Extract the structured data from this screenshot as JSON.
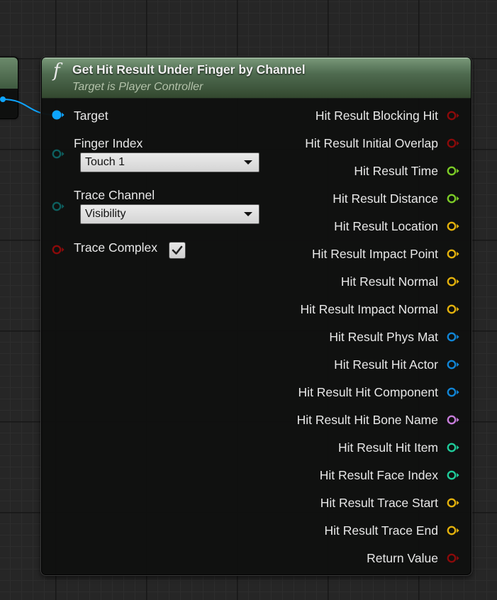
{
  "node": {
    "function_icon": "f",
    "title": "Get Hit Result Under Finger by Channel",
    "subtitle": "Target is Player Controller"
  },
  "inputs": [
    {
      "label": "Target",
      "icon": "object-pin-icon",
      "color": "#0ea5ff"
    },
    {
      "label": "Finger Index",
      "icon": "byte-pin-icon",
      "color": "#0d5f5f",
      "dropdown": "Touch 1"
    },
    {
      "label": "Trace Channel",
      "icon": "byte-pin-icon",
      "color": "#0d5f5f",
      "dropdown": "Visibility"
    },
    {
      "label": "Trace Complex",
      "icon": "bool-pin-icon",
      "color": "#8b0a0a",
      "checked": true
    }
  ],
  "outputs": [
    {
      "label": "Hit Result Blocking Hit",
      "icon": "bool-pin-icon",
      "color": "#8b0a0a"
    },
    {
      "label": "Hit Result Initial Overlap",
      "icon": "bool-pin-icon",
      "color": "#8b0a0a"
    },
    {
      "label": "Hit Result Time",
      "icon": "float-pin-icon",
      "color": "#7ccc27"
    },
    {
      "label": "Hit Result Distance",
      "icon": "float-pin-icon",
      "color": "#7ccc27"
    },
    {
      "label": "Hit Result Location",
      "icon": "vector-pin-icon",
      "color": "#e3b10c"
    },
    {
      "label": "Hit Result Impact Point",
      "icon": "vector-pin-icon",
      "color": "#e3b10c"
    },
    {
      "label": "Hit Result Normal",
      "icon": "vector-pin-icon",
      "color": "#e3b10c"
    },
    {
      "label": "Hit Result Impact Normal",
      "icon": "vector-pin-icon",
      "color": "#e3b10c"
    },
    {
      "label": "Hit Result Phys Mat",
      "icon": "object-pin-icon",
      "color": "#1185d6"
    },
    {
      "label": "Hit Result Hit Actor",
      "icon": "object-pin-icon",
      "color": "#1185d6"
    },
    {
      "label": "Hit Result Hit Component",
      "icon": "object-pin-icon",
      "color": "#1185d6"
    },
    {
      "label": "Hit Result Hit Bone Name",
      "icon": "name-pin-icon",
      "color": "#c77ddb"
    },
    {
      "label": "Hit Result Hit Item",
      "icon": "int-pin-icon",
      "color": "#1fcc9a"
    },
    {
      "label": "Hit Result Face Index",
      "icon": "int-pin-icon",
      "color": "#1fcc9a"
    },
    {
      "label": "Hit Result Trace Start",
      "icon": "vector-pin-icon",
      "color": "#e3b10c"
    },
    {
      "label": "Hit Result Trace End",
      "icon": "vector-pin-icon",
      "color": "#e3b10c"
    },
    {
      "label": "Return Value",
      "icon": "bool-pin-icon",
      "color": "#8b0a0a"
    }
  ],
  "colors": {
    "header_top": "#7a9a7a",
    "header_bottom": "#33482f",
    "wire": "#0ea5ff",
    "node_body": "#0f110f"
  }
}
